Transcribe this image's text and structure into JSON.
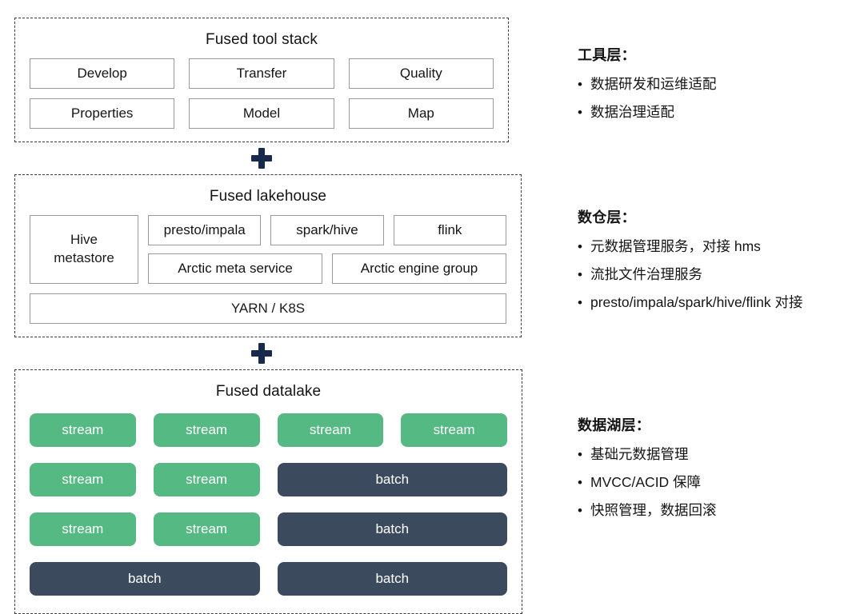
{
  "diagram": {
    "layers": [
      {
        "id": "tool-stack",
        "title": "Fused tool stack",
        "boxes": [
          "Develop",
          "Transfer",
          "Quality",
          "Properties",
          "Model",
          "Map"
        ]
      },
      {
        "id": "lakehouse",
        "title": "Fused lakehouse",
        "metastore": "Hive\nmetastore",
        "metastore_line1": "Hive",
        "metastore_line2": "metastore",
        "engines": [
          "presto/impala",
          "spark/hive",
          "flink"
        ],
        "services": [
          "Arctic meta service",
          "Arctic engine group"
        ],
        "resource_manager": "YARN / K8S"
      },
      {
        "id": "datalake",
        "title": "Fused datalake",
        "cells": [
          {
            "label": "stream",
            "kind": "stream",
            "span": 1
          },
          {
            "label": "stream",
            "kind": "stream",
            "span": 1
          },
          {
            "label": "stream",
            "kind": "stream",
            "span": 1
          },
          {
            "label": "stream",
            "kind": "stream",
            "span": 1
          },
          {
            "label": "stream",
            "kind": "stream",
            "span": 1
          },
          {
            "label": "stream",
            "kind": "stream",
            "span": 1
          },
          {
            "label": "batch",
            "kind": "batch",
            "span": 2
          },
          {
            "label": "stream",
            "kind": "stream",
            "span": 1
          },
          {
            "label": "stream",
            "kind": "stream",
            "span": 1
          },
          {
            "label": "batch",
            "kind": "batch",
            "span": 2
          },
          {
            "label": "batch",
            "kind": "batch",
            "span": 2
          },
          {
            "label": "batch",
            "kind": "batch",
            "span": 2
          }
        ]
      }
    ],
    "connector_icon": "plus-icon"
  },
  "notes": [
    {
      "id": "tool-layer",
      "heading": "工具层：",
      "bullet": "•",
      "items": [
        "数据研发和运维适配",
        "数据治理适配"
      ]
    },
    {
      "id": "warehouse-layer",
      "heading": "数仓层：",
      "bullet": "•",
      "items": [
        "元数据管理服务，对接 hms",
        "流批文件治理服务",
        "presto/impala/spark/hive/flink 对接"
      ]
    },
    {
      "id": "datalake-layer",
      "heading": "数据湖层：",
      "bullet": "•",
      "items": [
        "基础元数据管理",
        "MVCC/ACID 保障",
        "快照管理，数据回滚"
      ]
    }
  ],
  "colors": {
    "stream": "#55b983",
    "batch": "#3c4a5e",
    "plus": "#172a4e",
    "dashed_border": "#3a3a3a",
    "box_border": "#9a9a9a"
  }
}
